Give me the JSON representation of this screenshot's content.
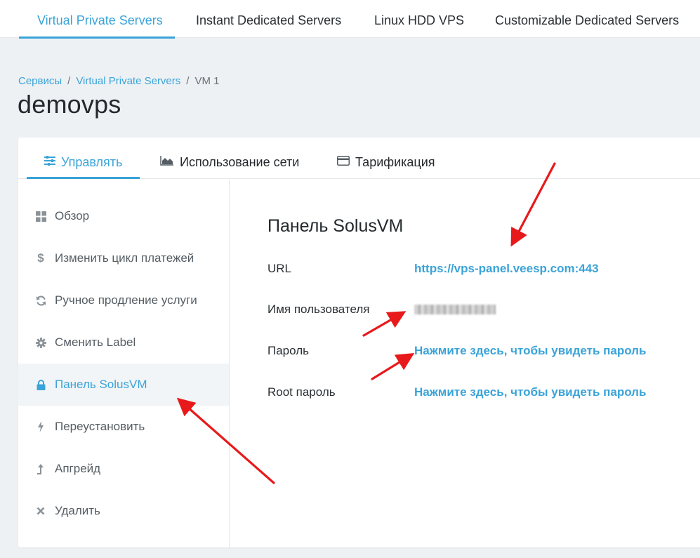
{
  "top_nav": {
    "tabs": [
      {
        "label": "Virtual Private Servers",
        "active": true
      },
      {
        "label": "Instant Dedicated Servers",
        "active": false
      },
      {
        "label": "Linux HDD VPS",
        "active": false
      },
      {
        "label": "Customizable Dedicated Servers",
        "active": false
      }
    ]
  },
  "breadcrumb": {
    "items": [
      "Сервисы",
      "Virtual Private Servers",
      "VM 1"
    ],
    "separator": "/"
  },
  "page_title": "demovps",
  "card_tabs": [
    {
      "label": "Управлять",
      "icon": "sliders-icon",
      "active": true
    },
    {
      "label": "Использование сети",
      "icon": "area-chart-icon",
      "active": false
    },
    {
      "label": "Тарификация",
      "icon": "credit-card-icon",
      "active": false
    }
  ],
  "sidebar": {
    "items": [
      {
        "label": "Обзор",
        "icon": "grid-icon"
      },
      {
        "label": "Изменить цикл платежей",
        "icon": "dollar-icon"
      },
      {
        "label": "Ручное продление услуги",
        "icon": "refresh-icon"
      },
      {
        "label": "Сменить Label",
        "icon": "gear-icon"
      },
      {
        "label": "Панель SolusVM",
        "icon": "lock-icon",
        "active": true
      },
      {
        "label": "Переустановить",
        "icon": "bolt-icon"
      },
      {
        "label": "Апгрейд",
        "icon": "level-up-icon"
      },
      {
        "label": "Удалить",
        "icon": "close-icon"
      }
    ]
  },
  "panel": {
    "title": "Панель SolusVM",
    "rows": [
      {
        "label": "URL",
        "value": "https://vps-panel.veesp.com:443"
      },
      {
        "label": "Имя пользователя",
        "value": ""
      },
      {
        "label": "Пароль",
        "value": "Нажмите здесь, чтобы увидеть пароль"
      },
      {
        "label": "Root пароль",
        "value": "Нажмите здесь, чтобы увидеть пароль"
      }
    ]
  },
  "colors": {
    "accent": "#3aa3d8",
    "background": "#eef1f3",
    "annotation_arrow": "#e8191b"
  }
}
